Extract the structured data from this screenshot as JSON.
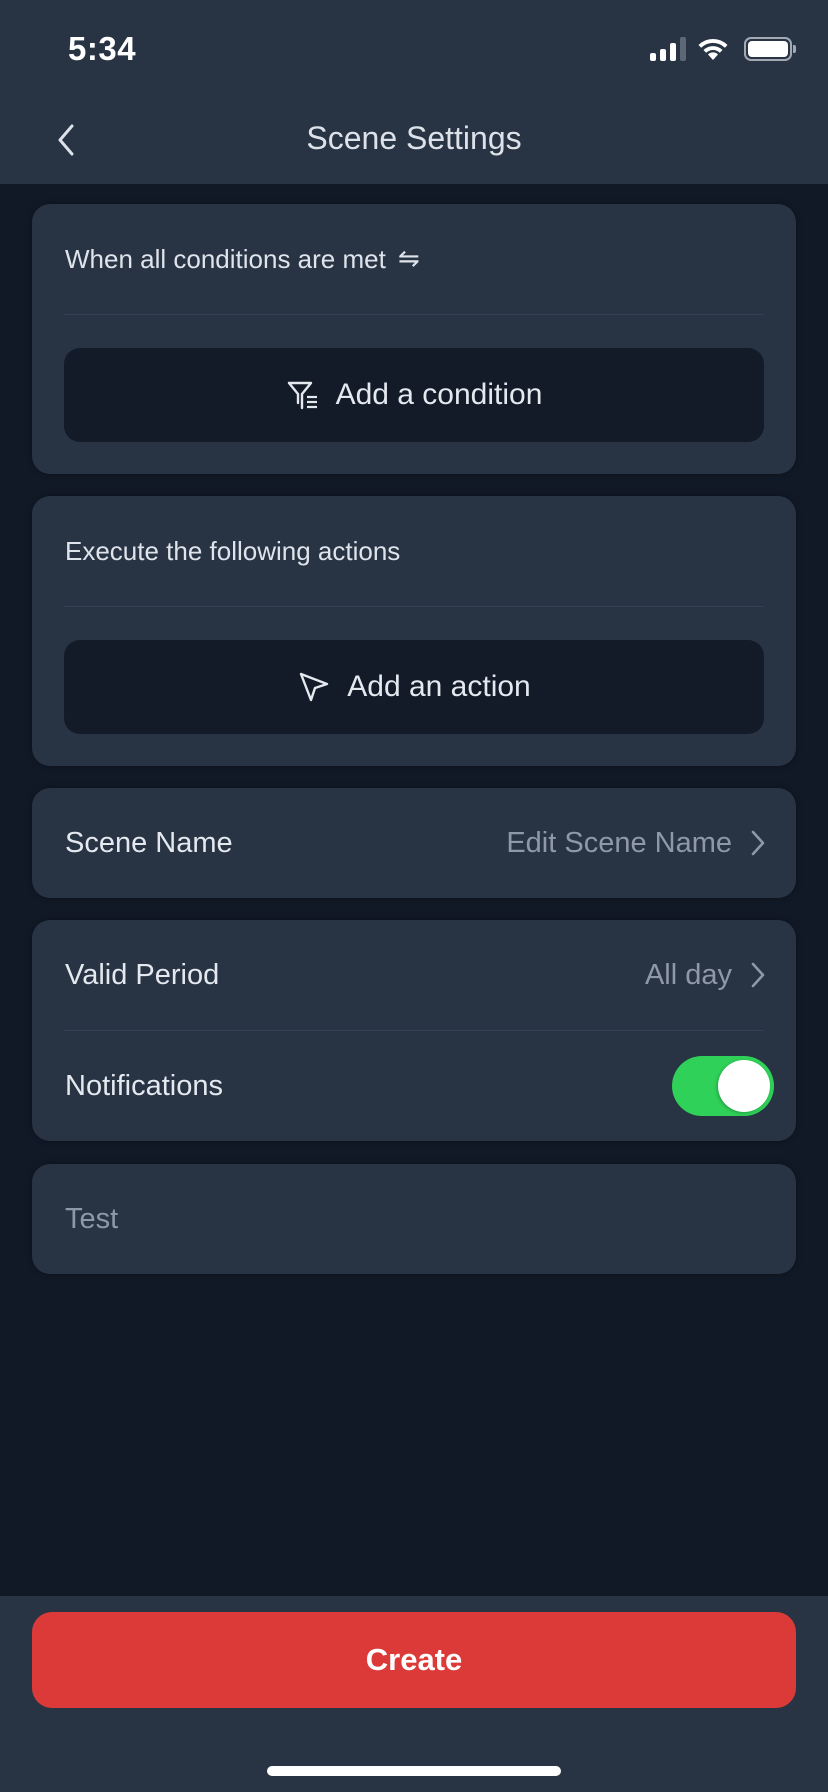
{
  "status_bar": {
    "time": "5:34",
    "icons": [
      "cellular-signal-icon",
      "wifi-icon",
      "battery-icon"
    ]
  },
  "nav": {
    "back_icon": "chevron-left-icon",
    "title": "Scene Settings"
  },
  "conditions": {
    "header": "When all conditions are met",
    "header_icon": "swap-arrows-icon",
    "header_icon_glyph": "⇋",
    "add_button": {
      "label": "Add a condition",
      "icon": "filter-list-icon"
    }
  },
  "actions": {
    "header": "Execute the following actions",
    "add_button": {
      "label": "Add an action",
      "icon": "navigation-arrow-icon"
    }
  },
  "scene_name": {
    "label": "Scene Name",
    "value": "Edit Scene Name"
  },
  "settings": {
    "valid_period": {
      "label": "Valid Period",
      "value": "All day"
    },
    "notifications": {
      "label": "Notifications",
      "enabled": true
    }
  },
  "test": {
    "label": "Test"
  },
  "footer": {
    "create_label": "Create"
  },
  "colors": {
    "background": "#111927",
    "surface": "#283343",
    "button_dark": "#131b28",
    "accent_red": "#dc3a38",
    "toggle_on": "#2fd158",
    "text_primary": "#e4e8ef",
    "text_secondary": "#8f98a6"
  }
}
